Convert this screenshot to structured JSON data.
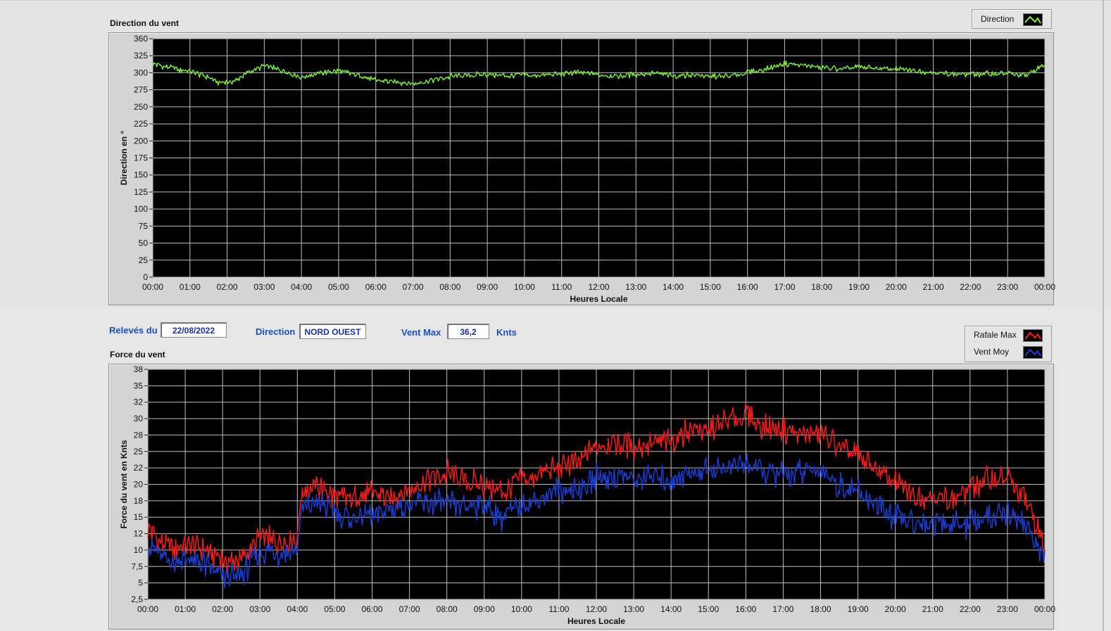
{
  "top_panel": {
    "title": "Direction du vent",
    "legend": [
      {
        "label": "Direction",
        "color": "#7cf233"
      }
    ]
  },
  "info_bar": {
    "releves_label": "Relevés du",
    "releves_value": "22/08/2022",
    "direction_label": "Direction",
    "direction_value": "NORD OUEST",
    "ventmax_label": "Vent Max",
    "ventmax_value": "36,2",
    "ventmax_unit": "Knts"
  },
  "bottom_panel": {
    "title": "Force du vent",
    "legend": [
      {
        "label": "Rafale Max",
        "color": "#ff1a1a"
      },
      {
        "label": "Vent Moy",
        "color": "#1a3fd9"
      }
    ]
  },
  "chart_data": [
    {
      "type": "line",
      "xlabel": "Heures Locale",
      "ylabel": "Direction en °",
      "ylim": [
        0,
        360
      ],
      "yticks": [
        "360",
        "325",
        "300",
        "275",
        "250",
        "225",
        "200",
        "175",
        "150",
        "125",
        "100",
        "75",
        "50",
        "25",
        "0"
      ],
      "xticks": [
        "00:00",
        "01:00",
        "02:00",
        "03:00",
        "04:00",
        "05:00",
        "06:00",
        "07:00",
        "08:00",
        "09:00",
        "10:00",
        "11:00",
        "12:00",
        "13:00",
        "14:00",
        "15:00",
        "16:00",
        "17:00",
        "18:00",
        "19:00",
        "20:00",
        "21:00",
        "22:00",
        "23:00",
        "00:00"
      ],
      "x_hours": [
        0,
        0.5,
        1,
        1.5,
        1.8,
        2.2,
        2.6,
        3,
        3.5,
        4,
        4.5,
        5,
        5.5,
        6,
        6.5,
        7,
        7.5,
        8,
        8.5,
        9,
        9.5,
        10,
        10.5,
        11,
        11.5,
        12,
        12.5,
        13,
        13.5,
        14,
        14.5,
        15,
        15.5,
        16,
        16.5,
        17,
        17.5,
        18,
        18.5,
        19,
        19.5,
        20,
        20.5,
        21,
        21.5,
        22,
        22.5,
        23,
        23.5,
        24
      ],
      "series": [
        {
          "name": "Direction",
          "color": "#7cf233",
          "values": [
            322,
            316,
            310,
            302,
            293,
            296,
            310,
            319,
            312,
            302,
            308,
            311,
            305,
            297,
            295,
            292,
            297,
            303,
            305,
            306,
            304,
            305,
            304,
            307,
            309,
            305,
            304,
            306,
            308,
            304,
            306,
            303,
            303,
            309,
            314,
            322,
            320,
            316,
            314,
            317,
            315,
            314,
            312,
            309,
            307,
            306,
            307,
            307,
            305,
            321
          ]
        }
      ]
    },
    {
      "type": "line",
      "xlabel": "Heures Locale",
      "ylabel": "Force du vent en Knts",
      "ylim": [
        2.5,
        38
      ],
      "yticks": [
        "38",
        "35",
        "32",
        "30",
        "28",
        "25",
        "22",
        "20",
        "18",
        "15",
        "12",
        "10",
        "7,5",
        "5",
        "2,5"
      ],
      "xticks": [
        "00:00",
        "01:00",
        "02:00",
        "03:00",
        "04:00",
        "05:00",
        "06:00",
        "07:00",
        "08:00",
        "09:00",
        "10:00",
        "11:00",
        "12:00",
        "13:00",
        "14:00",
        "15:00",
        "16:00",
        "17:00",
        "18:00",
        "19:00",
        "20:00",
        "21:00",
        "22:00",
        "23:00",
        "00:00"
      ],
      "x_hours": [
        0,
        0.5,
        1,
        1.5,
        2,
        2.5,
        3,
        3.5,
        4,
        4.1,
        4.5,
        5,
        5.5,
        6,
        6.5,
        7,
        7.5,
        8,
        8.5,
        9,
        9.5,
        10,
        10.5,
        11,
        11.5,
        12,
        12.5,
        13,
        13.5,
        14,
        14.5,
        15,
        15.5,
        16,
        16.5,
        17,
        17.5,
        18,
        18.5,
        19,
        19.5,
        20,
        20.5,
        21,
        21.5,
        22,
        22.5,
        23,
        23.5,
        24
      ],
      "series": [
        {
          "name": "Rafale Max",
          "color": "#ff1a1a",
          "values": [
            13.5,
            10.5,
            10.5,
            10.5,
            8.5,
            8.5,
            12,
            11.5,
            12,
            19,
            20,
            18,
            18,
            19,
            18,
            19.5,
            21,
            22,
            21,
            20,
            19,
            21,
            21.5,
            23,
            23.5,
            26,
            27,
            26,
            26.5,
            27,
            29,
            28.5,
            30,
            31,
            29,
            28.5,
            28,
            28,
            26,
            24.5,
            22.5,
            20.5,
            18.5,
            18.5,
            18,
            19.5,
            21,
            21,
            18,
            10.5
          ]
        },
        {
          "name": "Vent Moy",
          "color": "#1a3fd9",
          "values": [
            11,
            8.5,
            8.5,
            8,
            6,
            6,
            10,
            9.5,
            10,
            16,
            17.5,
            16,
            15,
            15.5,
            16.5,
            17,
            17.5,
            17,
            17,
            17,
            15,
            17,
            18,
            19.5,
            19.5,
            21.5,
            21.5,
            21,
            21.5,
            21,
            22,
            22.5,
            23,
            23.5,
            22,
            22,
            22,
            22.5,
            20,
            19,
            17,
            15,
            14.5,
            14.5,
            14,
            14,
            15,
            16,
            14,
            8.5
          ]
        }
      ]
    }
  ]
}
